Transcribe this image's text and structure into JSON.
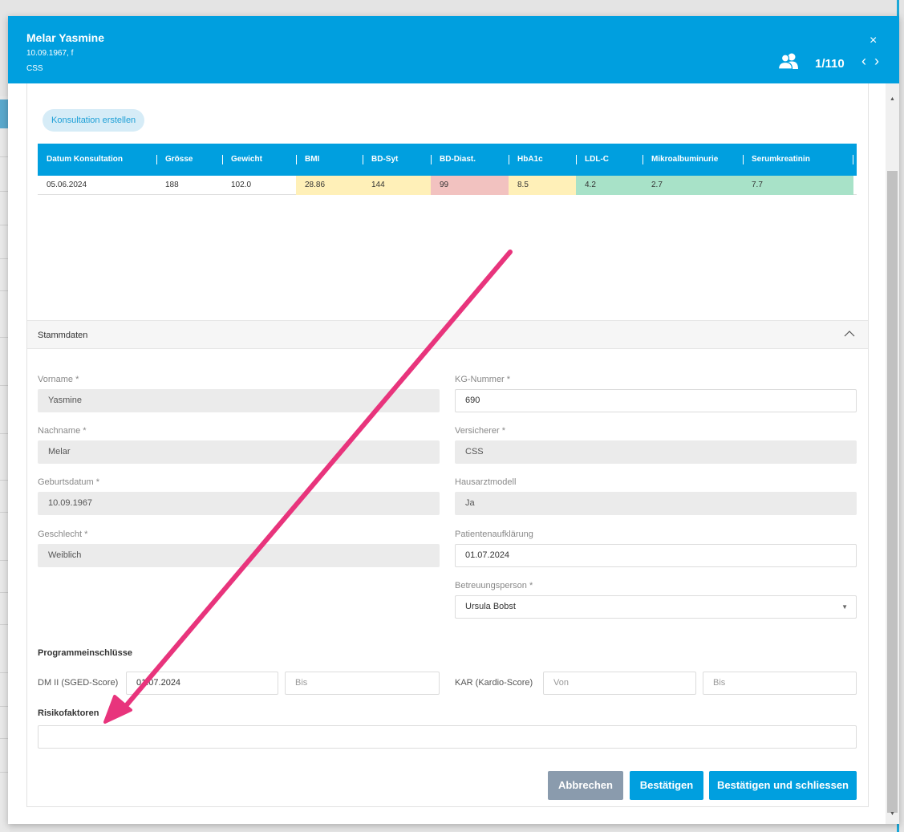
{
  "header": {
    "patient_name": "Melar Yasmine",
    "patient_dob_sex": "10.09.1967, f",
    "patient_insurer": "CSS",
    "close_symbol": "×",
    "patient_counter": "1/110",
    "prev_symbol": "‹",
    "next_symbol": "›",
    "accent_color": "#009fdf"
  },
  "consultation": {
    "create_button": "Konsultation erstellen",
    "columns": [
      "Datum Konsultation",
      "Grösse",
      "Gewicht",
      "BMI",
      "BD-Syt",
      "BD-Diast.",
      "HbA1c",
      "LDL-C",
      "Mikroalbuminurie",
      "Serumkreatinin"
    ],
    "rows": [
      {
        "cells": [
          "05.06.2024",
          "188",
          "102.0",
          "28.86",
          "144",
          "99",
          "8.5",
          "4.2",
          "2.7",
          "7.7"
        ],
        "status": [
          "none",
          "none",
          "none",
          "yellow",
          "yellow",
          "red",
          "yellow",
          "green",
          "green",
          "green"
        ]
      }
    ],
    "status_colors": {
      "yellow": "#fff0b8",
      "red": "#f2c2c0",
      "green": "#a8e2c8"
    }
  },
  "stammdaten": {
    "title": "Stammdaten",
    "collapse_icon": "chevron-up-icon",
    "vorname_label": "Vorname *",
    "vorname_value": "Yasmine",
    "nachname_label": "Nachname *",
    "nachname_value": "Melar",
    "geburtsdatum_label": "Geburtsdatum *",
    "geburtsdatum_value": "10.09.1967",
    "geschlecht_label": "Geschlecht *",
    "geschlecht_value": "Weiblich",
    "kg_label": "KG-Nummer *",
    "kg_value": "690",
    "versicherer_label": "Versicherer *",
    "versicherer_value": "CSS",
    "hausarzt_label": "Hausarztmodell",
    "hausarzt_value": "Ja",
    "aufklaerung_label": "Patientenaufklärung",
    "aufklaerung_value": "01.07.2024",
    "betreuung_label": "Betreuungsperson *",
    "betreuung_value": "Ursula Bobst"
  },
  "programme": {
    "title": "Programmeinschlüsse",
    "dm_label": "DM II (SGED-Score)",
    "dm_from_value": "01.07.2024",
    "dm_to_placeholder": "Bis",
    "kar_label": "KAR (Kardio-Score)",
    "kar_from_placeholder": "Von",
    "kar_to_placeholder": "Bis"
  },
  "risiko": {
    "title": "Risikofaktoren",
    "value": ""
  },
  "actions": {
    "cancel": "Abbrechen",
    "confirm": "Bestätigen",
    "confirm_close": "Bestätigen und schliessen"
  },
  "annotation": {
    "arrow_color": "#e8347c"
  }
}
